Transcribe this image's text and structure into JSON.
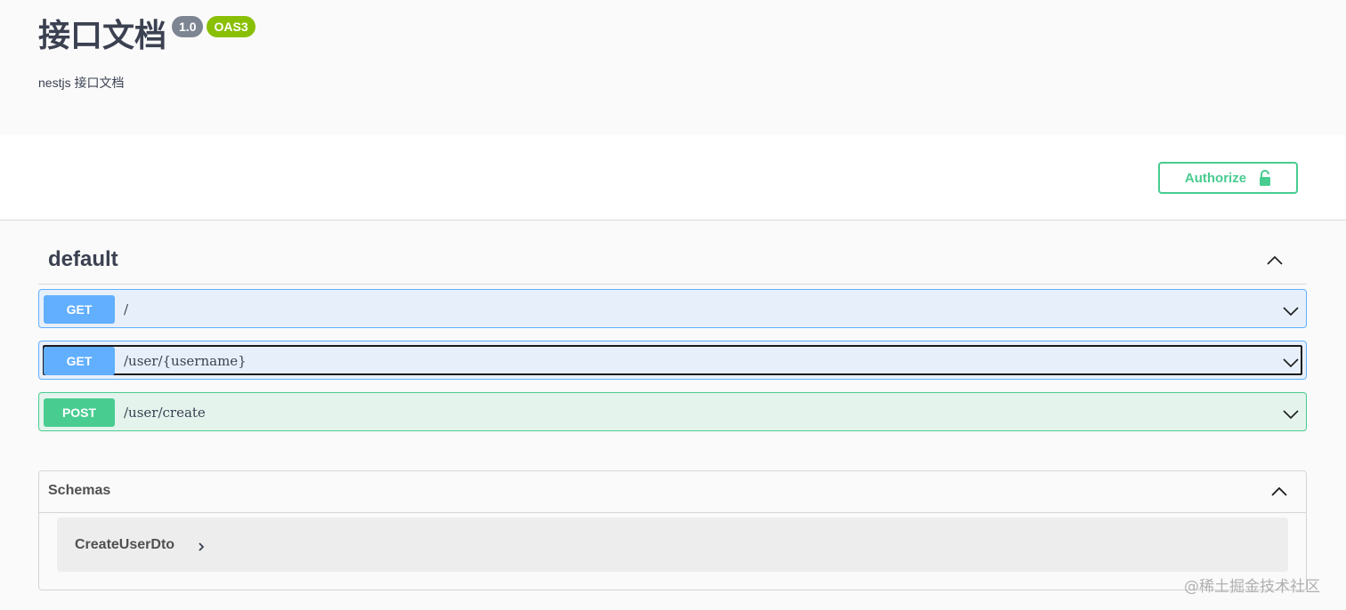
{
  "info": {
    "title": "接口文档",
    "version": "1.0",
    "oas": "OAS3",
    "description": "nestjs 接口文档"
  },
  "auth": {
    "label": "Authorize"
  },
  "tag": {
    "name": "default"
  },
  "operations": [
    {
      "method": "GET",
      "path": "/"
    },
    {
      "method": "GET",
      "path": "/user/{username}"
    },
    {
      "method": "POST",
      "path": "/user/create"
    }
  ],
  "schemas": {
    "title": "Schemas",
    "items": [
      {
        "name": "CreateUserDto"
      }
    ]
  },
  "watermark": "@稀土掘金技术社区",
  "colors": {
    "get": "#61affe",
    "post": "#49cc90",
    "version_badge": "#7d8492",
    "oas_badge": "#89bf04"
  }
}
